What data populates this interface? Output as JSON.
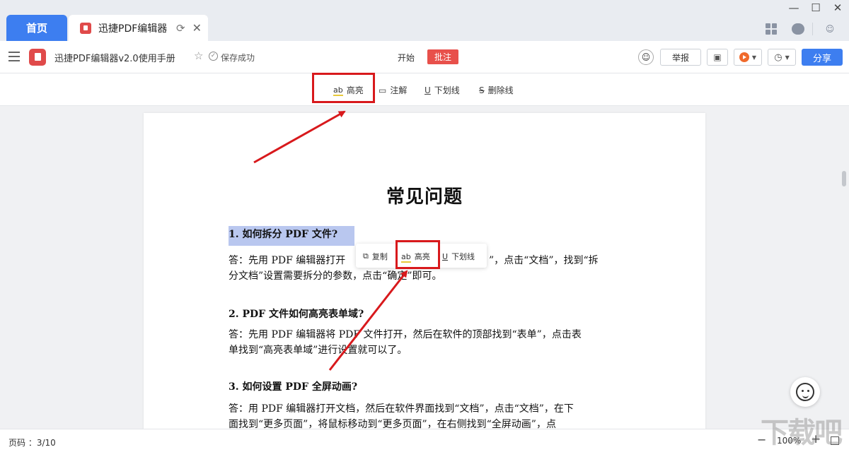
{
  "titlebar": {
    "home_tab": "首页",
    "doc_tab": "迅捷PDF编辑器",
    "refresh_icon": "refresh-icon",
    "close_icon": "close-icon"
  },
  "toolbar": {
    "doc_name": "迅捷PDF编辑器v2.0使用手册",
    "save_status": "保存成功",
    "menu_start": "开始",
    "menu_annotate": "批注",
    "report_label": "举报",
    "share_label": "分享"
  },
  "annot_toolbar": {
    "highlight": "高亮",
    "comment": "注解",
    "underline": "下划线",
    "strikethrough": "删除线"
  },
  "document": {
    "title": "常见问题",
    "q1": "1.  如何拆分 PDF 文件?",
    "a1_line1": "答：先用 PDF 编辑器打开",
    "a1_line1_end": "”，点击“文档”，找到“拆",
    "a1_line2": "分文档”设置需要拆分的参数，点击“确定”即可。",
    "q2": "2.  PDF 文件如何高亮表单域?",
    "a2_line1": "答：先用 PDF 编辑器将 PDF 文件打开，然后在软件的顶部找到“表单”，点击表",
    "a2_line2": "单找到“高亮表单域”进行设置就可以了。",
    "q3": "3.  如何设置 PDF 全屏动画?",
    "a3_line1": "答：用 PDF 编辑器打开文档，然后在软件界面找到“文档”，点击“文档”，在下",
    "a3_line2": "面找到“更多页面”，将鼠标移动到“更多页面”，在右侧找到“全屏动画”，点"
  },
  "popup": {
    "copy": "复制",
    "highlight": "高亮",
    "underline": "下划线"
  },
  "statusbar": {
    "page": "页码 ：3/10",
    "zoom": "100%"
  },
  "watermark": "下载吧",
  "colors": {
    "accent": "#3d7ef0",
    "annotate_active": "#e8504b",
    "callout_red": "#d8191c",
    "selection": "#b9c7ef"
  }
}
